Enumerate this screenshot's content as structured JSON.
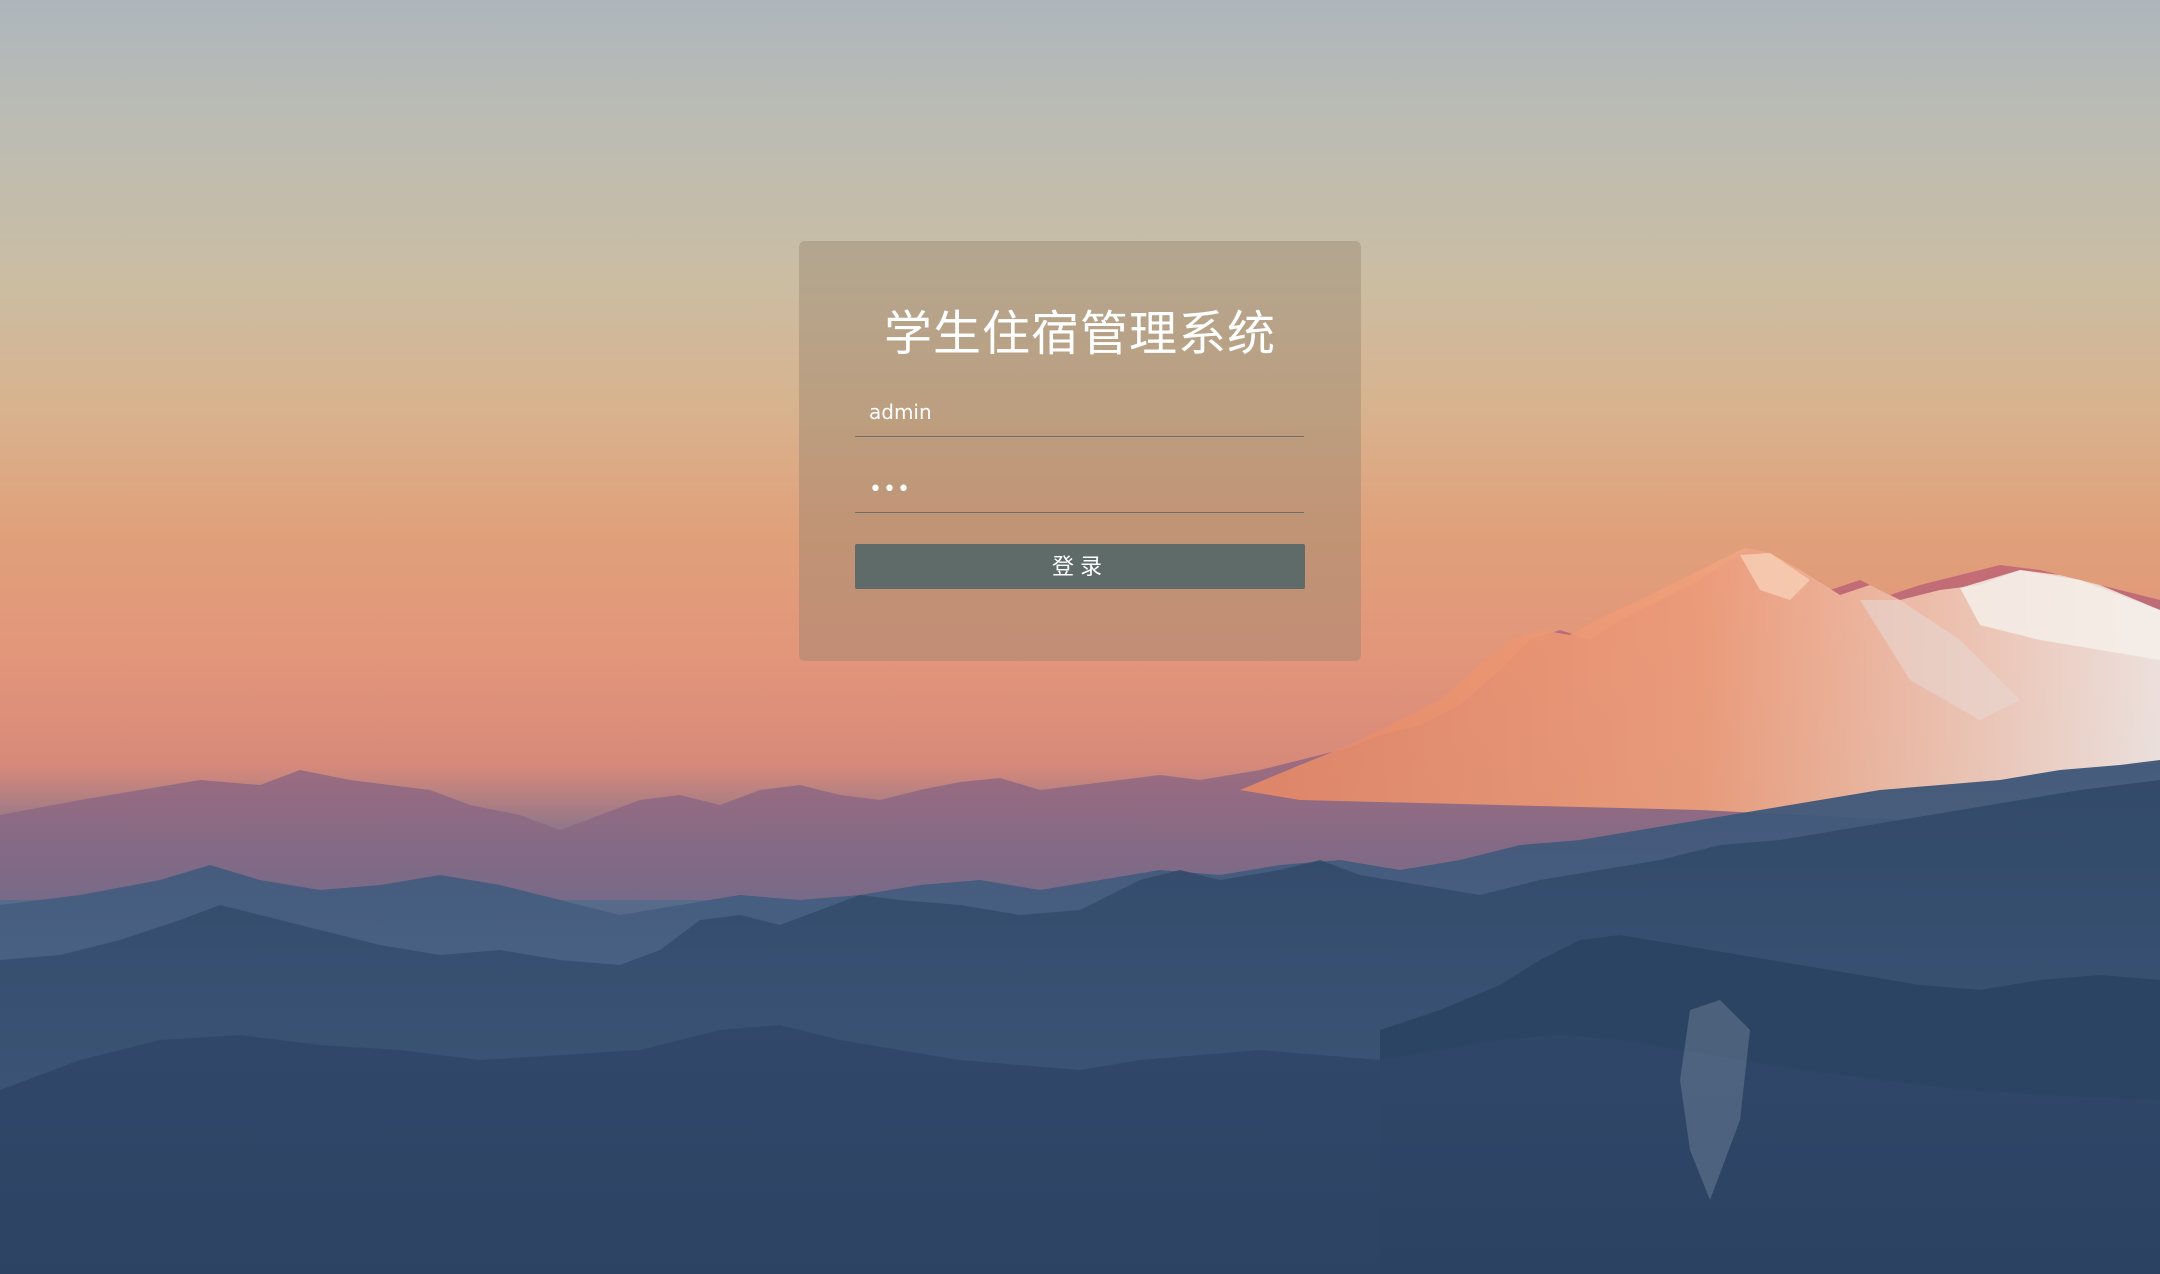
{
  "login": {
    "title": "学生住宿管理系统",
    "username_value": "admin",
    "password_value": "•••",
    "login_button": "登录"
  },
  "colors": {
    "button": "#5e6b69",
    "card": "rgba(150,130,110,0.42)",
    "text": "#ffffff"
  }
}
